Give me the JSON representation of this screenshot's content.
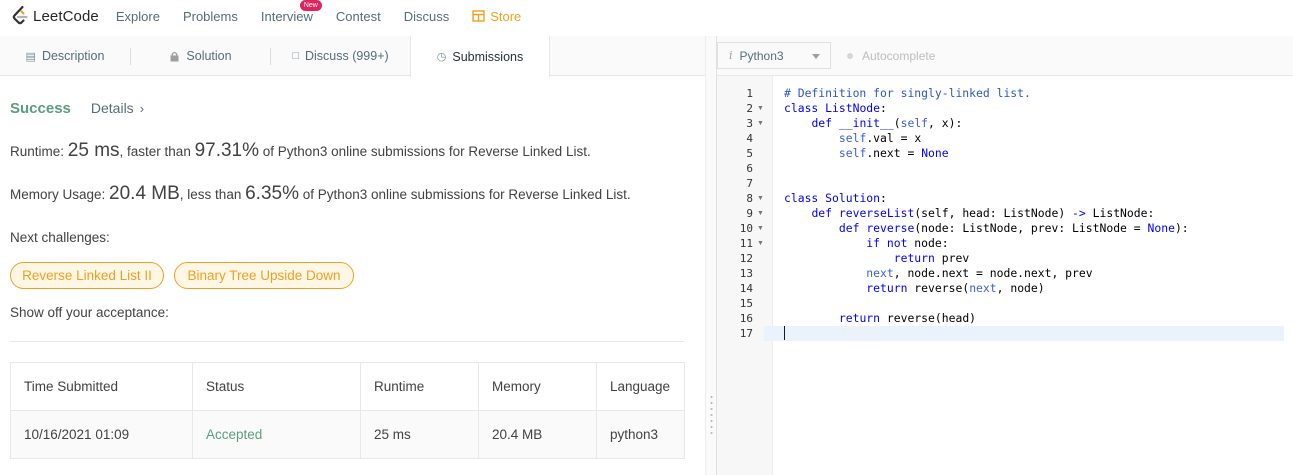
{
  "nav": {
    "logo_text": "LeetCode",
    "items": [
      "Explore",
      "Problems",
      "Interview",
      "Contest",
      "Discuss"
    ],
    "new_badge": "New",
    "store": "Store",
    "colors": {
      "store": "#f0a020",
      "badge": "#e0245e"
    }
  },
  "tabs": {
    "description": "Description",
    "solution": "Solution",
    "discuss": "Discuss (999+)",
    "submissions": "Submissions",
    "icons": [
      "document-icon",
      "lock-icon",
      "comment-icon",
      "clock-icon"
    ]
  },
  "result": {
    "status": "Success",
    "details": "Details",
    "runtime_prefix": "Runtime: ",
    "runtime_value": "25 ms",
    "runtime_mid": ", faster than ",
    "runtime_pct": "97.31%",
    "runtime_suffix": " of Python3 online submissions for Reverse Linked List.",
    "memory_prefix": "Memory Usage: ",
    "memory_value": "20.4 MB",
    "memory_mid": ", less than ",
    "memory_pct": "6.35%",
    "memory_suffix": " of Python3 online submissions for Reverse Linked List.",
    "next_label": "Next challenges:",
    "challenges": [
      "Reverse Linked List II",
      "Binary Tree Upside Down"
    ],
    "showoff": "Show off your acceptance:",
    "colors": {
      "success": "#5a9f7e",
      "chip": "#f0a020"
    }
  },
  "submissions_table": {
    "headers": [
      "Time Submitted",
      "Status",
      "Runtime",
      "Memory",
      "Language"
    ],
    "rows": [
      [
        "10/16/2021 01:09",
        "Accepted",
        "25 ms",
        "20.4 MB",
        "python3"
      ]
    ]
  },
  "editor": {
    "language": "Python3",
    "autocomplete": "Autocomplete",
    "line_numbers": [
      "1",
      "2",
      "3",
      "4",
      "5",
      "6",
      "7",
      "8",
      "9",
      "10",
      "11",
      "12",
      "13",
      "14",
      "15",
      "16",
      "17"
    ]
  }
}
